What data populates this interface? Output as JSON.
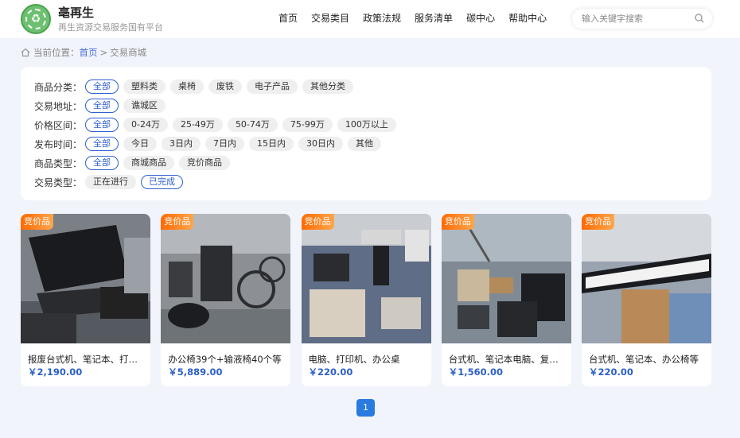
{
  "header": {
    "brand_name": "亳再生",
    "brand_sub": "再生资源交易服务国有平台",
    "logo_icon": "recycle-logo-icon",
    "nav": [
      "首页",
      "交易类目",
      "政策法规",
      "服务清单",
      "碳中心",
      "帮助中心"
    ],
    "search_placeholder": "输入关键字搜索"
  },
  "breadcrumb": {
    "label": "当前位置：",
    "home": "首页",
    "separator": ">",
    "current": "交易商城"
  },
  "filters": [
    {
      "label": "商品分类：",
      "options": [
        "全部",
        "塑料类",
        "桌椅",
        "废铁",
        "电子产品",
        "其他分类"
      ],
      "active": 0
    },
    {
      "label": "交易地址：",
      "options": [
        "全部",
        "谯城区"
      ],
      "active": 0
    },
    {
      "label": "价格区间：",
      "options": [
        "全部",
        "0-24万",
        "25-49万",
        "50-74万",
        "75-99万",
        "100万以上"
      ],
      "active": 0
    },
    {
      "label": "发布时间：",
      "options": [
        "全部",
        "今日",
        "3日内",
        "7日内",
        "15日内",
        "30日内",
        "其他"
      ],
      "active": 0
    },
    {
      "label": "商品类型：",
      "options": [
        "全部",
        "商城商品",
        "竞价商品"
      ],
      "active": 0
    },
    {
      "label": "交易类型：",
      "options": [
        "正在进行",
        "已完成"
      ],
      "active": 1
    }
  ],
  "products": [
    {
      "badge": "竞价品",
      "title": "报废台式机、笔记本、打印机等",
      "price": "￥2,190.00"
    },
    {
      "badge": "竞价品",
      "title": "办公椅39个+输液椅40个等",
      "price": "￥5,889.00"
    },
    {
      "badge": "竞价品",
      "title": "电脑、打印机、办公桌",
      "price": "￥220.00"
    },
    {
      "badge": "竞价品",
      "title": "台式机、笔记本电脑、复印机等",
      "price": "￥1,560.00"
    },
    {
      "badge": "竞价品",
      "title": "台式机、笔记本、办公椅等",
      "price": "￥220.00"
    }
  ],
  "pagination": {
    "current": "1"
  },
  "colors": {
    "accent": "#2f5fd0",
    "badge": "#ff6a00",
    "price": "#2b5fc8",
    "pager": "#2a7be0"
  }
}
